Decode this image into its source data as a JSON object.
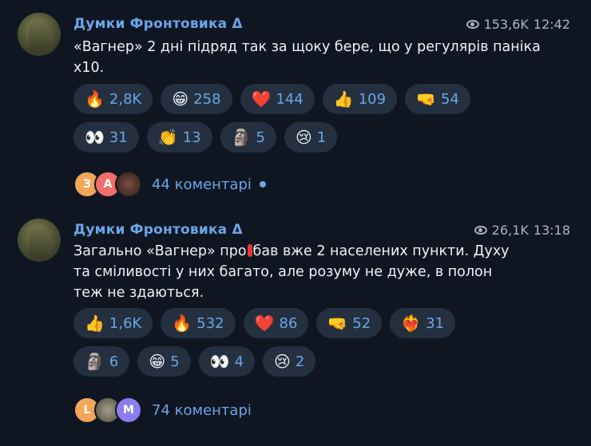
{
  "posts": [
    {
      "channel": "Думки Фронтовика Δ",
      "views": "153,6K",
      "time": "12:42",
      "text": "«Вагнер» 2 дні підряд так за щоку бере, що у регулярів паніка х10.",
      "reaction_rows": [
        [
          {
            "emoji": "🔥",
            "count": "2,8K"
          },
          {
            "emoji": "😁",
            "count": "258"
          },
          {
            "emoji": "❤️",
            "count": "144"
          },
          {
            "emoji": "👍",
            "count": "109"
          },
          {
            "emoji": "🤜",
            "count": "54"
          }
        ],
        [
          {
            "emoji": "👀",
            "count": "31"
          },
          {
            "emoji": "👏",
            "count": "13"
          },
          {
            "emoji": "🗿",
            "count": "5"
          },
          {
            "emoji": "😢",
            "count": "1"
          }
        ]
      ],
      "comment_avatars": [
        {
          "letter": "З",
          "color": "#f2a65a"
        },
        {
          "letter": "А",
          "color": "#ef6f6c"
        },
        {
          "letter": "",
          "color": "#5a3a2f"
        }
      ],
      "comments_label": "44 коментарі"
    },
    {
      "channel": "Думки Фронтовика Δ",
      "views": "26,1K",
      "time": "13:18",
      "text_before": "Загально «Вагнер» про",
      "text_after": "бав вже 2 населених пункти. Духу та сміливості у них багато, але розуму не дуже, в полон теж не здаються.",
      "reaction_rows": [
        [
          {
            "emoji": "👍",
            "count": "1,6K"
          },
          {
            "emoji": "🔥",
            "count": "532"
          },
          {
            "emoji": "❤️",
            "count": "86"
          },
          {
            "emoji": "🤜",
            "count": "52"
          },
          {
            "emoji": "❤️‍🔥",
            "count": "31"
          }
        ],
        [
          {
            "emoji": "🗿",
            "count": "6"
          },
          {
            "emoji": "😁",
            "count": "5"
          },
          {
            "emoji": "👀",
            "count": "4"
          },
          {
            "emoji": "😢",
            "count": "2"
          }
        ]
      ],
      "comment_avatars": [
        {
          "letter": "L",
          "color": "#f2a65a"
        },
        {
          "letter": "",
          "color": "#8a8576"
        },
        {
          "letter": "M",
          "color": "#8b7cf0"
        }
      ],
      "comments_label": "74 коментарі"
    }
  ],
  "colors": {
    "background": "#0f1622",
    "accent": "#6aa5e8",
    "chip": "#24303f"
  }
}
